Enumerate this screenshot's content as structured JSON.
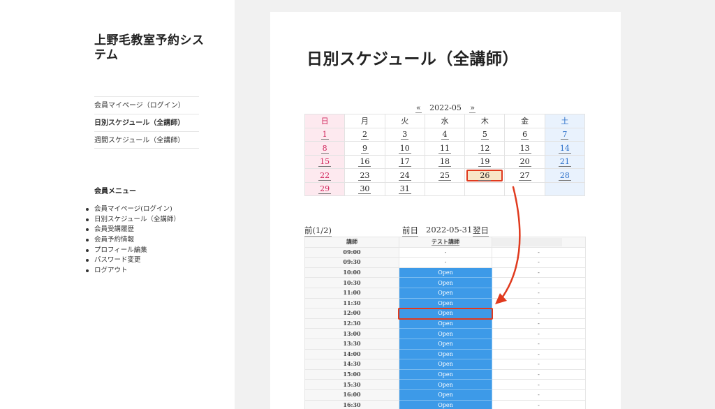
{
  "site": {
    "title": "上野毛教室予約システム"
  },
  "topnav": [
    {
      "label": "会員マイページ（ログイン）",
      "active": false
    },
    {
      "label": "日別スケジュール（全講師）",
      "active": true
    },
    {
      "label": "週間スケジュール（全講師）",
      "active": false
    }
  ],
  "member_menu": {
    "heading": "会員メニュー",
    "items": [
      "会員マイページ(ログイン)",
      "日別スケジュール（全講師）",
      "会員受講履歴",
      "会員予約情報",
      "プロフィール編集",
      "パスワード変更",
      "ログアウト"
    ]
  },
  "page": {
    "title": "日別スケジュール（全講師）"
  },
  "calendar": {
    "prev": "«",
    "month": "2022-05",
    "next": "»",
    "weekdays": [
      "日",
      "月",
      "火",
      "水",
      "木",
      "金",
      "土"
    ],
    "weeks": [
      [
        "1",
        "2",
        "3",
        "4",
        "5",
        "6",
        "7"
      ],
      [
        "8",
        "9",
        "10",
        "11",
        "12",
        "13",
        "14"
      ],
      [
        "15",
        "16",
        "17",
        "18",
        "19",
        "20",
        "21"
      ],
      [
        "22",
        "23",
        "24",
        "25",
        "26",
        "27",
        "28"
      ],
      [
        "29",
        "30",
        "31",
        "",
        "",
        "",
        ""
      ]
    ],
    "highlighted_day": "26"
  },
  "day_nav": {
    "prev_page": "前(1/2)",
    "prev_day": "前日",
    "date": "2022-05-31",
    "next_day": "翌日"
  },
  "schedule": {
    "headers": [
      "講師",
      "テスト講師",
      ""
    ],
    "rows": [
      {
        "time": "09:00",
        "col2": "-",
        "col3": "-",
        "open": false
      },
      {
        "time": "09:30",
        "col2": "-",
        "col3": "-",
        "open": false
      },
      {
        "time": "10:00",
        "col2": "Open",
        "col3": "-",
        "open": true
      },
      {
        "time": "10:30",
        "col2": "Open",
        "col3": "-",
        "open": true
      },
      {
        "time": "11:00",
        "col2": "Open",
        "col3": "-",
        "open": true
      },
      {
        "time": "11:30",
        "col2": "Open",
        "col3": "-",
        "open": true
      },
      {
        "time": "12:00",
        "col2": "Open",
        "col3": "-",
        "open": true
      },
      {
        "time": "12:30",
        "col2": "Open",
        "col3": "-",
        "open": true
      },
      {
        "time": "13:00",
        "col2": "Open",
        "col3": "-",
        "open": true
      },
      {
        "time": "13:30",
        "col2": "Open",
        "col3": "-",
        "open": true
      },
      {
        "time": "14:00",
        "col2": "Open",
        "col3": "-",
        "open": true
      },
      {
        "time": "14:30",
        "col2": "Open",
        "col3": "-",
        "open": true
      },
      {
        "time": "15:00",
        "col2": "Open",
        "col3": "-",
        "open": true
      },
      {
        "time": "15:30",
        "col2": "Open",
        "col3": "-",
        "open": true
      },
      {
        "time": "16:00",
        "col2": "Open",
        "col3": "-",
        "open": true
      },
      {
        "time": "16:30",
        "col2": "Open",
        "col3": "-",
        "open": true
      }
    ],
    "highlighted_time": "12:00"
  },
  "colors": {
    "open": "#3d9ae8",
    "sunday": "#d0265c",
    "saturday": "#2a6fc9",
    "annotation": "#e03a1e"
  }
}
